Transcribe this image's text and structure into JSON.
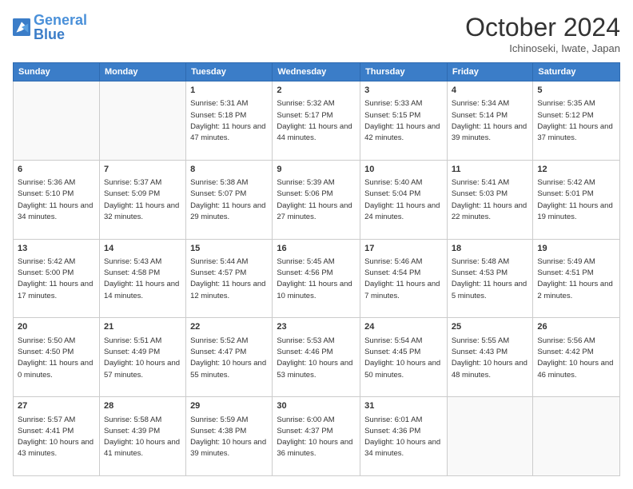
{
  "header": {
    "logo_general": "General",
    "logo_blue": "Blue",
    "month": "October 2024",
    "location": "Ichinoseki, Iwate, Japan"
  },
  "days_of_week": [
    "Sunday",
    "Monday",
    "Tuesday",
    "Wednesday",
    "Thursday",
    "Friday",
    "Saturday"
  ],
  "weeks": [
    [
      {
        "day": "",
        "sunrise": "",
        "sunset": "",
        "daylight": ""
      },
      {
        "day": "",
        "sunrise": "",
        "sunset": "",
        "daylight": ""
      },
      {
        "day": "1",
        "sunrise": "Sunrise: 5:31 AM",
        "sunset": "Sunset: 5:18 PM",
        "daylight": "Daylight: 11 hours and 47 minutes."
      },
      {
        "day": "2",
        "sunrise": "Sunrise: 5:32 AM",
        "sunset": "Sunset: 5:17 PM",
        "daylight": "Daylight: 11 hours and 44 minutes."
      },
      {
        "day": "3",
        "sunrise": "Sunrise: 5:33 AM",
        "sunset": "Sunset: 5:15 PM",
        "daylight": "Daylight: 11 hours and 42 minutes."
      },
      {
        "day": "4",
        "sunrise": "Sunrise: 5:34 AM",
        "sunset": "Sunset: 5:14 PM",
        "daylight": "Daylight: 11 hours and 39 minutes."
      },
      {
        "day": "5",
        "sunrise": "Sunrise: 5:35 AM",
        "sunset": "Sunset: 5:12 PM",
        "daylight": "Daylight: 11 hours and 37 minutes."
      }
    ],
    [
      {
        "day": "6",
        "sunrise": "Sunrise: 5:36 AM",
        "sunset": "Sunset: 5:10 PM",
        "daylight": "Daylight: 11 hours and 34 minutes."
      },
      {
        "day": "7",
        "sunrise": "Sunrise: 5:37 AM",
        "sunset": "Sunset: 5:09 PM",
        "daylight": "Daylight: 11 hours and 32 minutes."
      },
      {
        "day": "8",
        "sunrise": "Sunrise: 5:38 AM",
        "sunset": "Sunset: 5:07 PM",
        "daylight": "Daylight: 11 hours and 29 minutes."
      },
      {
        "day": "9",
        "sunrise": "Sunrise: 5:39 AM",
        "sunset": "Sunset: 5:06 PM",
        "daylight": "Daylight: 11 hours and 27 minutes."
      },
      {
        "day": "10",
        "sunrise": "Sunrise: 5:40 AM",
        "sunset": "Sunset: 5:04 PM",
        "daylight": "Daylight: 11 hours and 24 minutes."
      },
      {
        "day": "11",
        "sunrise": "Sunrise: 5:41 AM",
        "sunset": "Sunset: 5:03 PM",
        "daylight": "Daylight: 11 hours and 22 minutes."
      },
      {
        "day": "12",
        "sunrise": "Sunrise: 5:42 AM",
        "sunset": "Sunset: 5:01 PM",
        "daylight": "Daylight: 11 hours and 19 minutes."
      }
    ],
    [
      {
        "day": "13",
        "sunrise": "Sunrise: 5:42 AM",
        "sunset": "Sunset: 5:00 PM",
        "daylight": "Daylight: 11 hours and 17 minutes."
      },
      {
        "day": "14",
        "sunrise": "Sunrise: 5:43 AM",
        "sunset": "Sunset: 4:58 PM",
        "daylight": "Daylight: 11 hours and 14 minutes."
      },
      {
        "day": "15",
        "sunrise": "Sunrise: 5:44 AM",
        "sunset": "Sunset: 4:57 PM",
        "daylight": "Daylight: 11 hours and 12 minutes."
      },
      {
        "day": "16",
        "sunrise": "Sunrise: 5:45 AM",
        "sunset": "Sunset: 4:56 PM",
        "daylight": "Daylight: 11 hours and 10 minutes."
      },
      {
        "day": "17",
        "sunrise": "Sunrise: 5:46 AM",
        "sunset": "Sunset: 4:54 PM",
        "daylight": "Daylight: 11 hours and 7 minutes."
      },
      {
        "day": "18",
        "sunrise": "Sunrise: 5:48 AM",
        "sunset": "Sunset: 4:53 PM",
        "daylight": "Daylight: 11 hours and 5 minutes."
      },
      {
        "day": "19",
        "sunrise": "Sunrise: 5:49 AM",
        "sunset": "Sunset: 4:51 PM",
        "daylight": "Daylight: 11 hours and 2 minutes."
      }
    ],
    [
      {
        "day": "20",
        "sunrise": "Sunrise: 5:50 AM",
        "sunset": "Sunset: 4:50 PM",
        "daylight": "Daylight: 11 hours and 0 minutes."
      },
      {
        "day": "21",
        "sunrise": "Sunrise: 5:51 AM",
        "sunset": "Sunset: 4:49 PM",
        "daylight": "Daylight: 10 hours and 57 minutes."
      },
      {
        "day": "22",
        "sunrise": "Sunrise: 5:52 AM",
        "sunset": "Sunset: 4:47 PM",
        "daylight": "Daylight: 10 hours and 55 minutes."
      },
      {
        "day": "23",
        "sunrise": "Sunrise: 5:53 AM",
        "sunset": "Sunset: 4:46 PM",
        "daylight": "Daylight: 10 hours and 53 minutes."
      },
      {
        "day": "24",
        "sunrise": "Sunrise: 5:54 AM",
        "sunset": "Sunset: 4:45 PM",
        "daylight": "Daylight: 10 hours and 50 minutes."
      },
      {
        "day": "25",
        "sunrise": "Sunrise: 5:55 AM",
        "sunset": "Sunset: 4:43 PM",
        "daylight": "Daylight: 10 hours and 48 minutes."
      },
      {
        "day": "26",
        "sunrise": "Sunrise: 5:56 AM",
        "sunset": "Sunset: 4:42 PM",
        "daylight": "Daylight: 10 hours and 46 minutes."
      }
    ],
    [
      {
        "day": "27",
        "sunrise": "Sunrise: 5:57 AM",
        "sunset": "Sunset: 4:41 PM",
        "daylight": "Daylight: 10 hours and 43 minutes."
      },
      {
        "day": "28",
        "sunrise": "Sunrise: 5:58 AM",
        "sunset": "Sunset: 4:39 PM",
        "daylight": "Daylight: 10 hours and 41 minutes."
      },
      {
        "day": "29",
        "sunrise": "Sunrise: 5:59 AM",
        "sunset": "Sunset: 4:38 PM",
        "daylight": "Daylight: 10 hours and 39 minutes."
      },
      {
        "day": "30",
        "sunrise": "Sunrise: 6:00 AM",
        "sunset": "Sunset: 4:37 PM",
        "daylight": "Daylight: 10 hours and 36 minutes."
      },
      {
        "day": "31",
        "sunrise": "Sunrise: 6:01 AM",
        "sunset": "Sunset: 4:36 PM",
        "daylight": "Daylight: 10 hours and 34 minutes."
      },
      {
        "day": "",
        "sunrise": "",
        "sunset": "",
        "daylight": ""
      },
      {
        "day": "",
        "sunrise": "",
        "sunset": "",
        "daylight": ""
      }
    ]
  ]
}
